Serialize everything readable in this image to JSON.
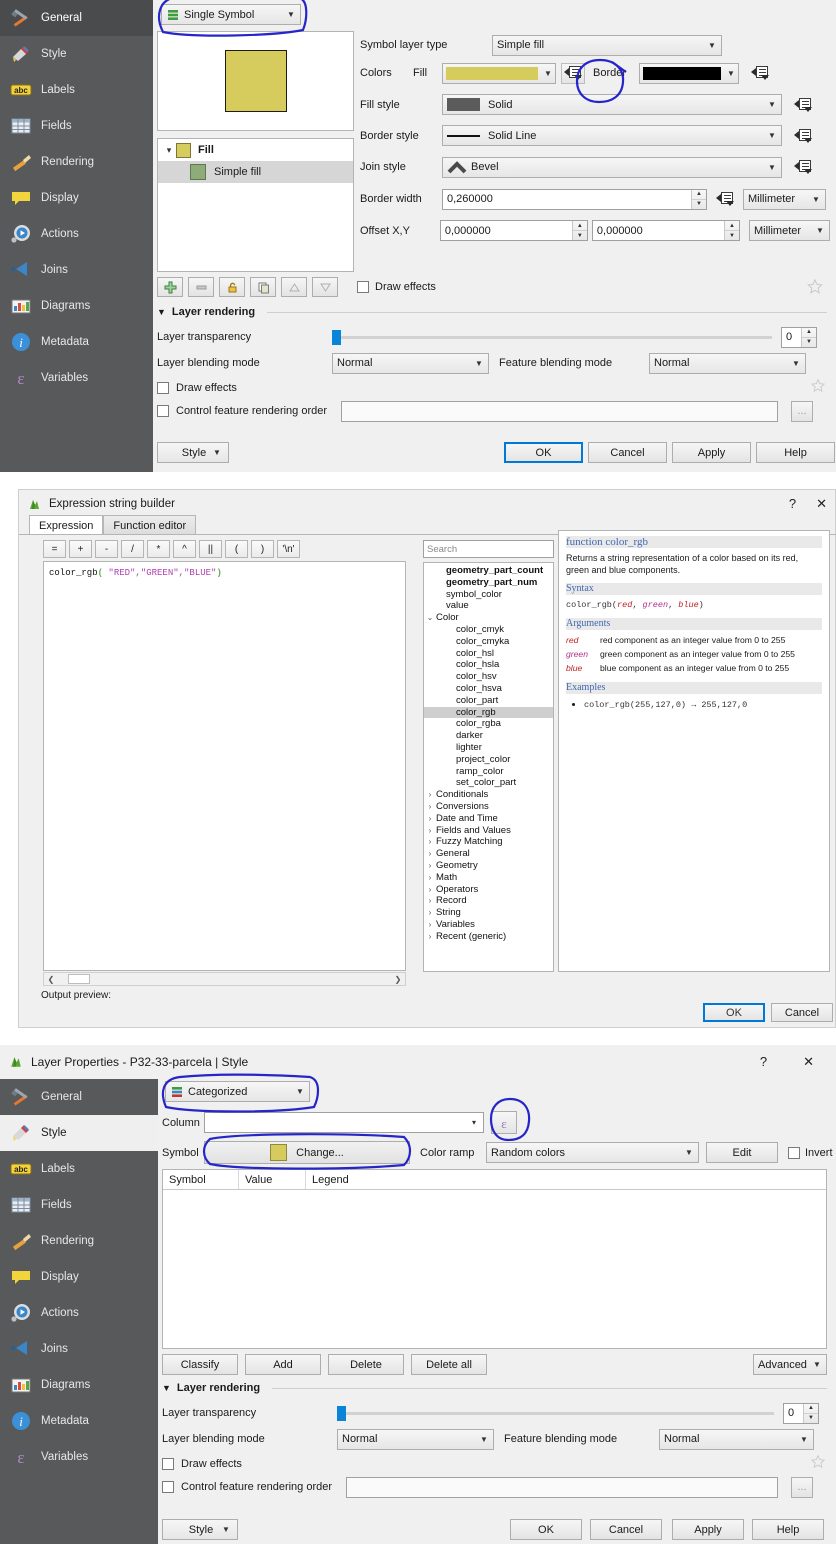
{
  "symbol_panel": {
    "renderer_combo": "Single Symbol",
    "preview_fill_color": "#d6cc5e",
    "preview_border_color": "#201c10",
    "tree": [
      {
        "label": "Fill",
        "swatch": "#d6cc5e",
        "bold": true,
        "selected": false,
        "expander": "⌄"
      },
      {
        "label": "Simple fill",
        "swatch": "#8fab79",
        "bold": false,
        "selected": true,
        "expander": ""
      }
    ],
    "toolbar_icons": [
      "add-symbol-layer",
      "remove-symbol-layer",
      "lock-layer",
      "duplicate-layer",
      "move-up",
      "move-down"
    ],
    "draw_effects_label": "Draw effects",
    "fields": {
      "symbol_layer_type_label": "Symbol layer type",
      "symbol_layer_type_value": "Simple fill",
      "colors_label": "Colors",
      "fill_label": "Fill",
      "fill_color": "#d6cc5e",
      "border_label": "Border",
      "border_color": "#000000",
      "fill_style_label": "Fill style",
      "fill_style_value": "Solid",
      "border_style_label": "Border style",
      "border_style_value": "Solid Line",
      "join_style_label": "Join style",
      "join_style_value": "Bevel",
      "border_width_label": "Border width",
      "border_width_value": "0,260000",
      "border_width_unit": "Millimeter",
      "offset_label": "Offset X,Y",
      "offset_x_value": "0,000000",
      "offset_y_value": "0,000000",
      "offset_unit": "Millimeter"
    },
    "layer_rendering": {
      "title": "Layer rendering",
      "transparency_label": "Layer transparency",
      "transparency_value": "0",
      "layer_blending_label": "Layer blending mode",
      "layer_blending_value": "Normal",
      "feature_blending_label": "Feature blending mode",
      "feature_blending_value": "Normal",
      "draw_effects_label": "Draw effects",
      "control_order_label": "Control feature rendering order",
      "control_order_value": "",
      "ellipsis": "..."
    },
    "buttons": {
      "style": "Style",
      "ok": "OK",
      "cancel": "Cancel",
      "apply": "Apply",
      "help": "Help"
    }
  },
  "sidebar_top": {
    "items": [
      {
        "label": "General",
        "icon": "hammer-wrench-icon",
        "selected": true
      },
      {
        "label": "Style",
        "icon": "paintbrush-icon",
        "selected": false
      },
      {
        "label": "Labels",
        "icon": "abc-label-icon",
        "selected": false
      },
      {
        "label": "Fields",
        "icon": "table-grid-icon",
        "selected": false
      },
      {
        "label": "Rendering",
        "icon": "broom-icon",
        "selected": false
      },
      {
        "label": "Display",
        "icon": "speech-bubble-icon",
        "selected": false
      },
      {
        "label": "Actions",
        "icon": "gear-play-icon",
        "selected": false
      },
      {
        "label": "Joins",
        "icon": "join-arrow-icon",
        "selected": false
      },
      {
        "label": "Diagrams",
        "icon": "diagram-chart-icon",
        "selected": false
      },
      {
        "label": "Metadata",
        "icon": "info-circle-icon",
        "selected": false
      },
      {
        "label": "Variables",
        "icon": "epsilon-icon",
        "selected": false
      }
    ]
  },
  "expression_dialog": {
    "title": "Expression string builder",
    "help_btn": "?",
    "close_btn": "✕",
    "tabs": [
      {
        "label": "Expression",
        "selected": true
      },
      {
        "label": "Function editor",
        "selected": false
      }
    ],
    "operators": [
      "=",
      "+",
      "-",
      "/",
      "*",
      "^",
      "||",
      "(",
      ")",
      "'\\n'"
    ],
    "expression_text": "color_rgb( \"RED\",\"GREEN\",\"BLUE\")",
    "expression_parts": {
      "func": "color_rgb",
      "open": "(",
      "args": " \"RED\",\"GREEN\",\"BLUE\"",
      "close": ")"
    },
    "search_placeholder": "Search",
    "output_preview_label": "Output preview:",
    "tree": [
      {
        "label": "geometry_part_count",
        "indent": 1,
        "bold": true,
        "expander": "",
        "selected": false
      },
      {
        "label": "geometry_part_num",
        "indent": 1,
        "bold": true,
        "expander": "",
        "selected": false
      },
      {
        "label": "symbol_color",
        "indent": 1,
        "bold": false,
        "expander": "",
        "selected": false
      },
      {
        "label": "value",
        "indent": 1,
        "bold": false,
        "expander": "",
        "selected": false
      },
      {
        "label": "Color",
        "indent": 0,
        "bold": false,
        "expander": "⌄",
        "selected": false
      },
      {
        "label": "color_cmyk",
        "indent": 2,
        "bold": false,
        "expander": "",
        "selected": false
      },
      {
        "label": "color_cmyka",
        "indent": 2,
        "bold": false,
        "expander": "",
        "selected": false
      },
      {
        "label": "color_hsl",
        "indent": 2,
        "bold": false,
        "expander": "",
        "selected": false
      },
      {
        "label": "color_hsla",
        "indent": 2,
        "bold": false,
        "expander": "",
        "selected": false
      },
      {
        "label": "color_hsv",
        "indent": 2,
        "bold": false,
        "expander": "",
        "selected": false
      },
      {
        "label": "color_hsva",
        "indent": 2,
        "bold": false,
        "expander": "",
        "selected": false
      },
      {
        "label": "color_part",
        "indent": 2,
        "bold": false,
        "expander": "",
        "selected": false
      },
      {
        "label": "color_rgb",
        "indent": 2,
        "bold": false,
        "expander": "",
        "selected": true
      },
      {
        "label": "color_rgba",
        "indent": 2,
        "bold": false,
        "expander": "",
        "selected": false
      },
      {
        "label": "darker",
        "indent": 2,
        "bold": false,
        "expander": "",
        "selected": false
      },
      {
        "label": "lighter",
        "indent": 2,
        "bold": false,
        "expander": "",
        "selected": false
      },
      {
        "label": "project_color",
        "indent": 2,
        "bold": false,
        "expander": "",
        "selected": false
      },
      {
        "label": "ramp_color",
        "indent": 2,
        "bold": false,
        "expander": "",
        "selected": false
      },
      {
        "label": "set_color_part",
        "indent": 2,
        "bold": false,
        "expander": "",
        "selected": false
      },
      {
        "label": "Conditionals",
        "indent": 0,
        "bold": false,
        "expander": "›",
        "selected": false
      },
      {
        "label": "Conversions",
        "indent": 0,
        "bold": false,
        "expander": "›",
        "selected": false
      },
      {
        "label": "Date and Time",
        "indent": 0,
        "bold": false,
        "expander": "›",
        "selected": false
      },
      {
        "label": "Fields and Values",
        "indent": 0,
        "bold": false,
        "expander": "›",
        "selected": false
      },
      {
        "label": "Fuzzy Matching",
        "indent": 0,
        "bold": false,
        "expander": "›",
        "selected": false
      },
      {
        "label": "General",
        "indent": 0,
        "bold": false,
        "expander": "›",
        "selected": false
      },
      {
        "label": "Geometry",
        "indent": 0,
        "bold": false,
        "expander": "›",
        "selected": false
      },
      {
        "label": "Math",
        "indent": 0,
        "bold": false,
        "expander": "›",
        "selected": false
      },
      {
        "label": "Operators",
        "indent": 0,
        "bold": false,
        "expander": "›",
        "selected": false
      },
      {
        "label": "Record",
        "indent": 0,
        "bold": false,
        "expander": "›",
        "selected": false
      },
      {
        "label": "String",
        "indent": 0,
        "bold": false,
        "expander": "›",
        "selected": false
      },
      {
        "label": "Variables",
        "indent": 0,
        "bold": false,
        "expander": "›",
        "selected": false
      },
      {
        "label": "Recent (generic)",
        "indent": 0,
        "bold": false,
        "expander": "›",
        "selected": false
      }
    ],
    "help": {
      "heading": "function color_rgb",
      "description": "Returns a string representation of a color based on its red, green and blue components.",
      "syntax_heading": "Syntax",
      "syntax_func": "color_rgb",
      "syntax_paren_open": "(",
      "syntax_red": "red",
      "syntax_green": "green",
      "syntax_blue": "blue",
      "syntax_paren_close": ")",
      "arguments_heading": "Arguments",
      "arguments": [
        {
          "name": "red",
          "desc": "red component as an integer value from 0 to 255"
        },
        {
          "name": "green",
          "desc": "green component as an integer value from 0 to 255"
        },
        {
          "name": "blue",
          "desc": "blue component as an integer value from 0 to 255"
        }
      ],
      "examples_heading": "Examples",
      "examples": [
        "color_rgb(255,127,0) → 255,127,0"
      ]
    },
    "buttons": {
      "ok": "OK",
      "cancel": "Cancel"
    }
  },
  "layer_properties": {
    "title": "Layer Properties - P32-33-parcela | Style",
    "help_btn": "?",
    "close_btn": "✕",
    "renderer_combo": "Categorized",
    "column_label": "Column",
    "column_value": "",
    "expression_btn_icon": "epsilon-icon",
    "symbol_label": "Symbol",
    "symbol_change_btn": "Change...",
    "symbol_swatch": "#d6cc5e",
    "color_ramp_label": "Color ramp",
    "color_ramp_value": "Random colors",
    "edit_btn": "Edit",
    "invert_label": "Invert",
    "table_headers": [
      "Symbol",
      "Value",
      "Legend"
    ],
    "table_rows": [],
    "action_buttons": [
      "Classify",
      "Add",
      "Delete",
      "Delete all"
    ],
    "advanced_btn": "Advanced",
    "layer_rendering": {
      "title": "Layer rendering",
      "transparency_label": "Layer transparency",
      "transparency_value": "0",
      "layer_blending_label": "Layer blending mode",
      "layer_blending_value": "Normal",
      "feature_blending_label": "Feature blending mode",
      "feature_blending_value": "Normal",
      "draw_effects_label": "Draw effects",
      "control_order_label": "Control feature rendering order",
      "ellipsis": "..."
    },
    "buttons": {
      "style": "Style",
      "ok": "OK",
      "cancel": "Cancel",
      "apply": "Apply",
      "help": "Help"
    }
  },
  "annotations": {
    "color": "#2626c8"
  }
}
